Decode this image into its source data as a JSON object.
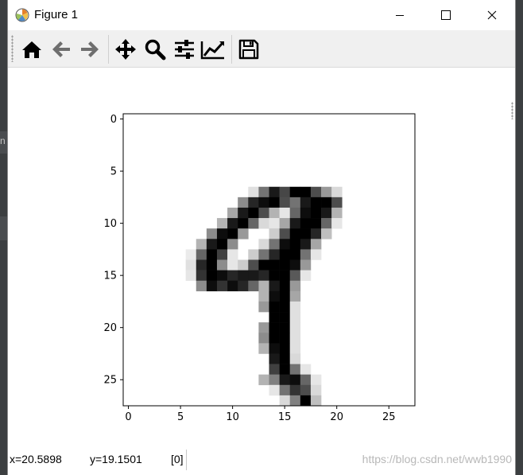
{
  "window": {
    "title": "Figure 1"
  },
  "background": {
    "side_char": "n"
  },
  "toolbar": {
    "buttons": [
      {
        "icon": "home-icon"
      },
      {
        "icon": "arrow-left-icon"
      },
      {
        "icon": "arrow-right-icon"
      },
      {
        "icon": "move-icon"
      },
      {
        "icon": "zoom-icon"
      },
      {
        "icon": "sliders-icon"
      },
      {
        "icon": "line-chart-icon"
      },
      {
        "icon": "save-icon"
      }
    ]
  },
  "status": {
    "x": "x=20.5898",
    "y": "y=19.1501",
    "value": "[0]",
    "watermark": "https://blog.csdn.net/wwb1990"
  },
  "chart_data": {
    "type": "heatmap",
    "colormap": "gray_r",
    "size": [
      28,
      28
    ],
    "xticks": [
      "0",
      "5",
      "10",
      "15",
      "20",
      "25"
    ],
    "yticks": [
      "0",
      "5",
      "10",
      "15",
      "20",
      "25"
    ],
    "xlim": [
      -0.5,
      27.5
    ],
    "ylim": [
      27.5,
      -0.5
    ],
    "pixels": [
      [
        7,
        12,
        0.12
      ],
      [
        7,
        13,
        0.55
      ],
      [
        7,
        14,
        0.9
      ],
      [
        7,
        15,
        0.72
      ],
      [
        7,
        16,
        1.0
      ],
      [
        7,
        17,
        1.0
      ],
      [
        7,
        18,
        0.7
      ],
      [
        7,
        19,
        0.4
      ],
      [
        7,
        20,
        0.15
      ],
      [
        8,
        11,
        0.45
      ],
      [
        8,
        12,
        0.85
      ],
      [
        8,
        13,
        0.95
      ],
      [
        8,
        14,
        1.0
      ],
      [
        8,
        15,
        0.7
      ],
      [
        8,
        16,
        0.55
      ],
      [
        8,
        17,
        0.9
      ],
      [
        8,
        18,
        1.0
      ],
      [
        8,
        19,
        1.0
      ],
      [
        8,
        20,
        0.7
      ],
      [
        9,
        10,
        0.35
      ],
      [
        9,
        11,
        0.9
      ],
      [
        9,
        12,
        1.0
      ],
      [
        9,
        13,
        0.7
      ],
      [
        9,
        14,
        0.3
      ],
      [
        9,
        15,
        0.1
      ],
      [
        9,
        16,
        0.6
      ],
      [
        9,
        17,
        0.95
      ],
      [
        9,
        18,
        1.0
      ],
      [
        9,
        19,
        0.9
      ],
      [
        9,
        20,
        0.3
      ],
      [
        10,
        9,
        0.3
      ],
      [
        10,
        10,
        0.9
      ],
      [
        10,
        11,
        1.0
      ],
      [
        10,
        12,
        0.6
      ],
      [
        10,
        13,
        0.15
      ],
      [
        10,
        14,
        0.1
      ],
      [
        10,
        15,
        0.35
      ],
      [
        10,
        16,
        0.9
      ],
      [
        10,
        17,
        1.0
      ],
      [
        10,
        18,
        1.0
      ],
      [
        10,
        19,
        0.6
      ],
      [
        10,
        20,
        0.1
      ],
      [
        11,
        8,
        0.45
      ],
      [
        11,
        9,
        0.95
      ],
      [
        11,
        10,
        1.0
      ],
      [
        11,
        11,
        0.4
      ],
      [
        11,
        14,
        0.2
      ],
      [
        11,
        15,
        0.7
      ],
      [
        11,
        16,
        1.0
      ],
      [
        11,
        17,
        1.0
      ],
      [
        11,
        18,
        0.85
      ],
      [
        11,
        19,
        0.25
      ],
      [
        12,
        7,
        0.3
      ],
      [
        12,
        8,
        0.9
      ],
      [
        12,
        9,
        1.0
      ],
      [
        12,
        10,
        0.45
      ],
      [
        12,
        13,
        0.15
      ],
      [
        12,
        14,
        0.55
      ],
      [
        12,
        15,
        0.95
      ],
      [
        12,
        16,
        1.0
      ],
      [
        12,
        17,
        0.9
      ],
      [
        12,
        18,
        0.35
      ],
      [
        13,
        6,
        0.08
      ],
      [
        13,
        7,
        0.6
      ],
      [
        13,
        8,
        1.0
      ],
      [
        13,
        9,
        0.75
      ],
      [
        13,
        10,
        0.1
      ],
      [
        13,
        12,
        0.2
      ],
      [
        13,
        13,
        0.55
      ],
      [
        13,
        14,
        0.85
      ],
      [
        13,
        15,
        1.0
      ],
      [
        13,
        16,
        1.0
      ],
      [
        13,
        17,
        0.55
      ],
      [
        13,
        18,
        0.1
      ],
      [
        14,
        6,
        0.12
      ],
      [
        14,
        7,
        0.85
      ],
      [
        14,
        8,
        1.0
      ],
      [
        14,
        9,
        0.45
      ],
      [
        14,
        10,
        0.1
      ],
      [
        14,
        11,
        0.2
      ],
      [
        14,
        12,
        0.7
      ],
      [
        14,
        13,
        1.0
      ],
      [
        14,
        14,
        1.0
      ],
      [
        14,
        15,
        1.0
      ],
      [
        14,
        16,
        0.95
      ],
      [
        14,
        17,
        0.4
      ],
      [
        15,
        6,
        0.1
      ],
      [
        15,
        7,
        0.8
      ],
      [
        15,
        8,
        1.0
      ],
      [
        15,
        9,
        0.95
      ],
      [
        15,
        10,
        0.85
      ],
      [
        15,
        11,
        0.9
      ],
      [
        15,
        12,
        0.9
      ],
      [
        15,
        13,
        0.85
      ],
      [
        15,
        14,
        1.0
      ],
      [
        15,
        15,
        1.0
      ],
      [
        15,
        16,
        0.65
      ],
      [
        15,
        17,
        0.1
      ],
      [
        16,
        7,
        0.45
      ],
      [
        16,
        8,
        0.95
      ],
      [
        16,
        9,
        0.8
      ],
      [
        16,
        10,
        0.95
      ],
      [
        16,
        11,
        0.85
      ],
      [
        16,
        12,
        0.6
      ],
      [
        16,
        13,
        0.3
      ],
      [
        16,
        14,
        0.9
      ],
      [
        16,
        15,
        1.0
      ],
      [
        16,
        16,
        0.4
      ],
      [
        17,
        13,
        0.3
      ],
      [
        17,
        14,
        0.95
      ],
      [
        17,
        15,
        1.0
      ],
      [
        17,
        16,
        0.35
      ],
      [
        18,
        13,
        0.4
      ],
      [
        18,
        14,
        1.0
      ],
      [
        18,
        15,
        1.0
      ],
      [
        18,
        16,
        0.12
      ],
      [
        19,
        14,
        1.0
      ],
      [
        19,
        15,
        1.0
      ],
      [
        19,
        16,
        0.12
      ],
      [
        20,
        13,
        0.4
      ],
      [
        20,
        14,
        1.0
      ],
      [
        20,
        15,
        1.0
      ],
      [
        20,
        16,
        0.12
      ],
      [
        21,
        13,
        0.45
      ],
      [
        21,
        14,
        1.0
      ],
      [
        21,
        15,
        1.0
      ],
      [
        21,
        16,
        0.12
      ],
      [
        22,
        13,
        0.3
      ],
      [
        22,
        14,
        0.95
      ],
      [
        22,
        15,
        1.0
      ],
      [
        22,
        16,
        0.12
      ],
      [
        23,
        14,
        0.9
      ],
      [
        23,
        15,
        1.0
      ],
      [
        23,
        16,
        0.15
      ],
      [
        24,
        14,
        0.75
      ],
      [
        24,
        15,
        1.0
      ],
      [
        24,
        16,
        0.55
      ],
      [
        24,
        17,
        0.1
      ],
      [
        25,
        13,
        0.3
      ],
      [
        25,
        14,
        0.5
      ],
      [
        25,
        15,
        0.9
      ],
      [
        25,
        16,
        0.95
      ],
      [
        25,
        17,
        0.6
      ],
      [
        25,
        18,
        0.1
      ],
      [
        26,
        14,
        0.1
      ],
      [
        26,
        15,
        0.55
      ],
      [
        26,
        16,
        0.8
      ],
      [
        26,
        17,
        0.7
      ],
      [
        26,
        18,
        0.15
      ],
      [
        27,
        15,
        0.15
      ],
      [
        27,
        16,
        0.5
      ],
      [
        27,
        17,
        1.0
      ],
      [
        27,
        18,
        0.25
      ]
    ]
  }
}
